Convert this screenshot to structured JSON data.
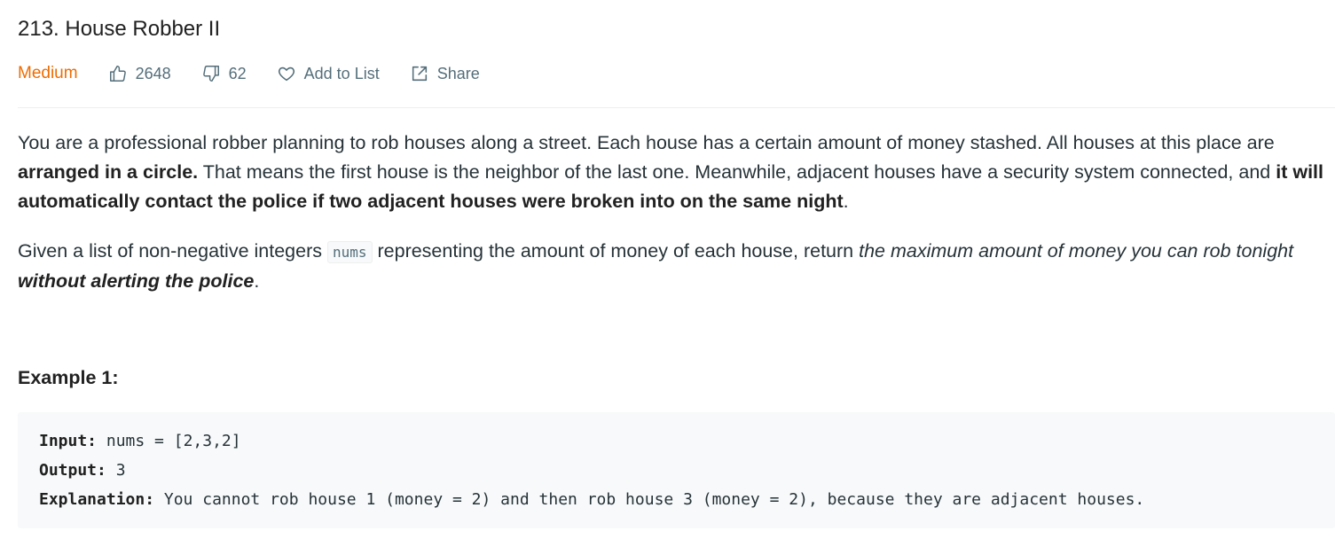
{
  "problem": {
    "title": "213. House Robber II",
    "difficulty": "Medium",
    "likes": "2648",
    "dislikes": "62",
    "add_to_list_label": "Add to List",
    "share_label": "Share"
  },
  "description": {
    "p1_a": "You are a professional robber planning to rob houses along a street. Each house has a certain amount of money stashed. All houses at this place are ",
    "p1_b": "arranged in a circle.",
    "p1_c": " That means the first house is the neighbor of the last one. Meanwhile, adjacent houses have a security system connected, and ",
    "p1_d": "it will automatically contact the police if two adjacent houses were broken into on the same night",
    "p1_e": ".",
    "p2_a": "Given a list of non-negative integers ",
    "p2_code": "nums",
    "p2_b": " representing the amount of money of each house, return ",
    "p2_c": "the maximum amount of money you can rob tonight ",
    "p2_d": "without alerting the police",
    "p2_e": "."
  },
  "example1": {
    "heading": "Example 1:",
    "input_label": "Input:",
    "input_value": " nums = [2,3,2]",
    "output_label": "Output:",
    "output_value": " 3",
    "explanation_label": "Explanation:",
    "explanation_value": " You cannot rob house 1 (money = 2) and then rob house 3 (money = 2), because they are adjacent houses."
  },
  "colors": {
    "difficulty_medium": "#ef6c00",
    "meta_text": "#546e7a",
    "text": "#263238",
    "code_bg": "#f7f9fa"
  },
  "icons": {
    "like": "thumbs-up-icon",
    "dislike": "thumbs-down-icon",
    "add_to_list": "heart-icon",
    "share": "share-icon"
  }
}
